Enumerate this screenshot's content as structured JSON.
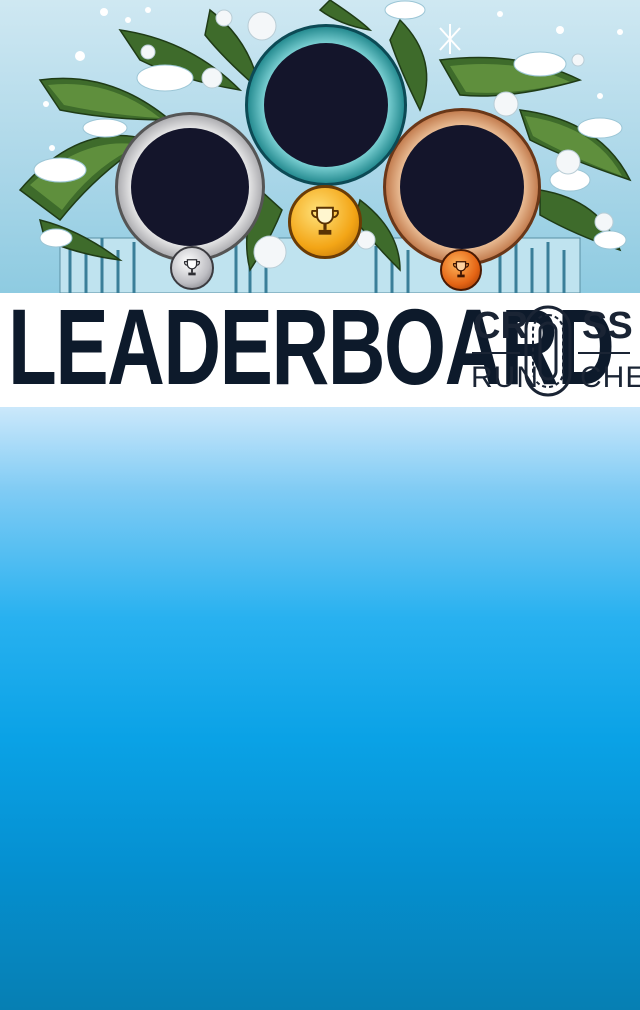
{
  "header": {
    "title": "LEADERBOARD",
    "brand": {
      "top_left": "CR",
      "top_right": "SS",
      "bottom_left": "RUN",
      "bottom_right": "CHE",
      "emblem": "track-o-icon"
    }
  },
  "podium": [
    {
      "rank": "first",
      "medal": "gold",
      "icon": "trophy-icon"
    },
    {
      "rank": "second",
      "medal": "silver",
      "icon": "trophy-icon"
    },
    {
      "rank": "third",
      "medal": "bronze",
      "icon": "trophy-icon"
    }
  ],
  "colors": {
    "gold": "#f3a516",
    "silver": "#bdbdc2",
    "bronze": "#e46414",
    "title": "#0d1a2b",
    "background_top": "#cbe8fb",
    "background_bottom": "#067fb3"
  }
}
